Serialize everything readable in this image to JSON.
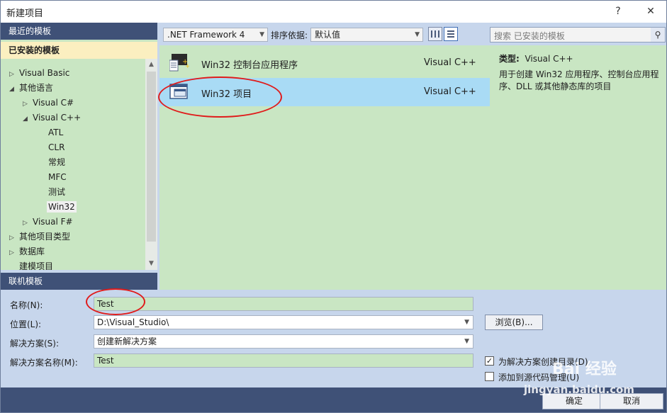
{
  "window": {
    "title": "新建项目",
    "help_glyph": "?",
    "close_glyph": "✕"
  },
  "sidebar": {
    "recent_label": "最近的模板",
    "installed_label": "已安装的模板",
    "online_label": "联机模板",
    "tree": [
      {
        "label": "Visual Basic",
        "arrow": "▷"
      },
      {
        "label": "其他语言",
        "arrow": "◢"
      },
      {
        "label": "Visual C#",
        "arrow": "▷"
      },
      {
        "label": "Visual C++",
        "arrow": "◢"
      },
      {
        "label": "ATL",
        "arrow": ""
      },
      {
        "label": "CLR",
        "arrow": ""
      },
      {
        "label": "常规",
        "arrow": ""
      },
      {
        "label": "MFC",
        "arrow": ""
      },
      {
        "label": "测试",
        "arrow": ""
      },
      {
        "label": "Win32",
        "arrow": ""
      },
      {
        "label": "Visual F#",
        "arrow": "▷"
      },
      {
        "label": "其他项目类型",
        "arrow": "▷"
      },
      {
        "label": "数据库",
        "arrow": "▷"
      },
      {
        "label": "建模项目",
        "arrow": ""
      }
    ]
  },
  "toolbar": {
    "framework": ".NET Framework 4",
    "sort_label": "排序依据:",
    "sort_value": "默认值",
    "search_placeholder": "搜索 已安装的模板",
    "search_glyph": "⚲"
  },
  "templates": [
    {
      "name": "Win32 控制台应用程序",
      "language": "Visual C++"
    },
    {
      "name": "Win32 项目",
      "language": "Visual C++"
    }
  ],
  "details": {
    "type_label": "类型:",
    "type_value": "Visual C++",
    "description": "用于创建 Win32 应用程序、控制台应用程序、DLL 或其他静态库的项目"
  },
  "form": {
    "name_label": "名称(N):",
    "name_value": "Test",
    "location_label": "位置(L):",
    "location_value": "D:\\Visual_Studio\\",
    "solution_label": "解决方案(S):",
    "solution_value": "创建新解决方案",
    "solution_name_label": "解决方案名称(M):",
    "solution_name_value": "Test",
    "browse_label": "浏览(B)...",
    "create_dir_label": "为解决方案创建目录(D)",
    "create_dir_checked": "✓",
    "source_control_label": "添加到源代码管理(U)"
  },
  "actions": {
    "ok": "确定",
    "cancel": "取消"
  },
  "watermark": {
    "brand": "Bai 经验",
    "url": "jingyan.baidu.com"
  },
  "colors": {
    "accent_header": "#3f5177",
    "selected_bg": "#a9dbf5",
    "panel_green": "#c9e6c3",
    "annotation": "#e01b1b"
  }
}
